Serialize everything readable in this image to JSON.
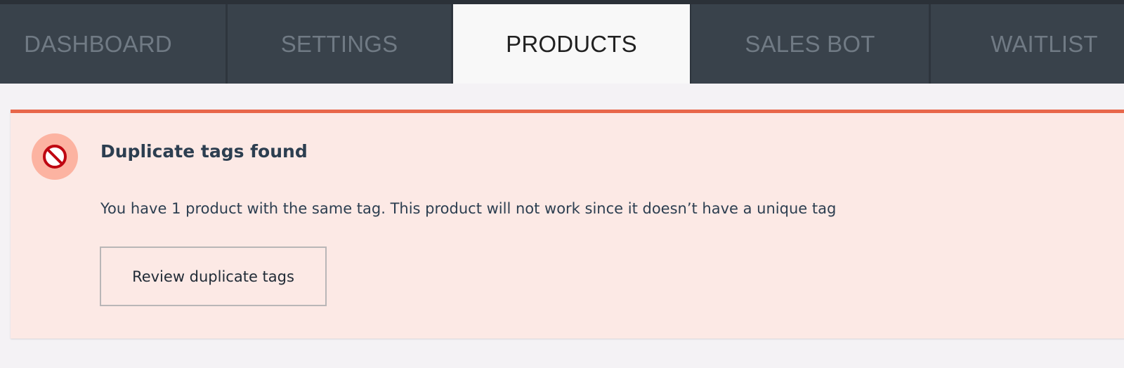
{
  "tabs": [
    {
      "label": "DASHBOARD",
      "active": false
    },
    {
      "label": "SETTINGS",
      "active": false
    },
    {
      "label": "PRODUCTS",
      "active": true
    },
    {
      "label": "SALES BOT",
      "active": false
    },
    {
      "label": "WAITLIST",
      "active": false
    }
  ],
  "alert": {
    "icon": "prohibited-icon",
    "title": "Duplicate tags found",
    "message": "You have 1 product with the same tag. This product will not work since it doesn’t have a unique tag",
    "button_label": "Review duplicate tags"
  },
  "colors": {
    "tabbar_bg": "#39424b",
    "active_tab_bg": "#f8f8f8",
    "alert_bg": "#fce9e5",
    "alert_accent": "#e8664a",
    "icon_bg": "#fcb3a1",
    "icon_stroke": "#bf0711"
  }
}
